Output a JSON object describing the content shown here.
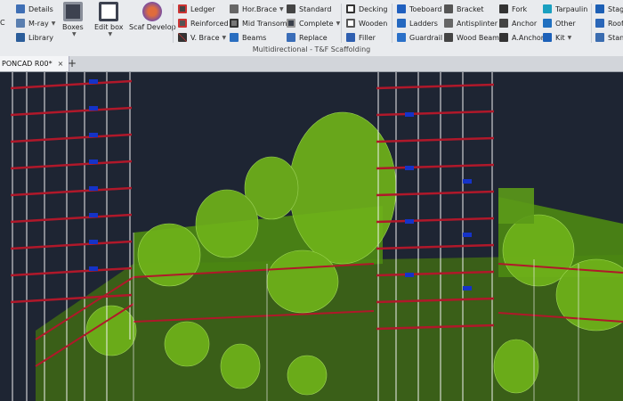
{
  "ribbon": {
    "col1": [
      "Details",
      "M-ray",
      "Library"
    ],
    "col1_prefix": "C",
    "big": [
      {
        "label": "Boxes",
        "color": "#3d4250"
      },
      {
        "label": "Edit box",
        "color": "#5a6070"
      },
      {
        "label": "Scaf Develop",
        "color": "#7b4fa0"
      }
    ],
    "colA": [
      "Ledger",
      "Reinforced",
      "V. Brace"
    ],
    "colB": [
      "Hor.Brace",
      "Mid Transom",
      "Beams"
    ],
    "colC": [
      "Standard",
      "Complete",
      "Replace"
    ],
    "colD": [
      "Decking",
      "Wooden",
      "Filler"
    ],
    "colE": [
      "Toeboard",
      "Ladders",
      "Guardrail"
    ],
    "colF": [
      "Bracket",
      "Antisplinter",
      "Wood Beam"
    ],
    "colG": [
      "Fork",
      "Anchor",
      "A.Anchor"
    ],
    "colH": [
      "Tarpaulin",
      "Other",
      "Kit"
    ],
    "colI": [
      "Stage",
      "Roof",
      "Stand"
    ],
    "group_label": "Multidirectional - T&F Scaffolding"
  },
  "tabs": {
    "document": "PONCAD R00*",
    "close": "×",
    "new": "+"
  },
  "colors": {
    "ribbon_bg": "#e9ebee",
    "viewport_bg": "#1e2533",
    "scaffold_red": "#b0182a",
    "scaffold_white": "#f0f0f0",
    "dome_green": "#6fb21a",
    "deck_blue": "#1533c8"
  },
  "icons": [
    "details-icon",
    "mray-icon",
    "library-icon",
    "boxes-icon",
    "edit-box-icon",
    "scaf-develop-icon",
    "ledger-icon",
    "brace-icon",
    "standard-icon",
    "decking-icon",
    "toeboard-icon",
    "bracket-icon",
    "fork-icon",
    "tarpaulin-icon",
    "stage-icon"
  ]
}
